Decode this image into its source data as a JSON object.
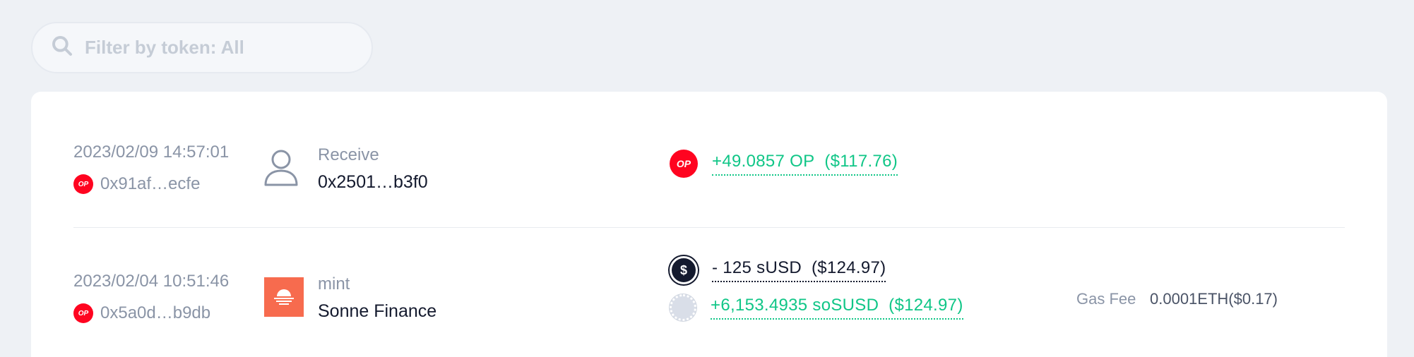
{
  "filter": {
    "placeholder": "Filter by token: All"
  },
  "transactions": [
    {
      "datetime": "2023/02/09 14:57:01",
      "chain_badge": "OP",
      "tx_hash": "0x91af…ecfe",
      "type": "Receive",
      "counterparty": "0x2501…b3f0",
      "tokens": [
        {
          "icon": "op-token-icon",
          "amount": "+49.0857 OP",
          "usd": "($117.76)",
          "color": "#10c687"
        }
      ]
    },
    {
      "datetime": "2023/02/04 10:51:46",
      "chain_badge": "OP",
      "tx_hash": "0x5a0d…b9db",
      "type": "mint",
      "counterparty": "Sonne Finance",
      "tokens": [
        {
          "icon": "susd-token-icon",
          "amount": "- 125 sUSD",
          "usd": "($124.97)",
          "color": "#141a2e"
        },
        {
          "icon": "sosusd-token-icon",
          "amount": "+6,153.4935 soSUSD",
          "usd": "($124.97)",
          "color": "#10c687"
        }
      ],
      "gas_label": "Gas Fee",
      "gas_value": "0.0001ETH($0.17)"
    }
  ],
  "colors": {
    "positive": "#10c687",
    "negative": "#141a2e",
    "op_red": "#ff0420",
    "sonne_orange": "#f76b4e"
  }
}
